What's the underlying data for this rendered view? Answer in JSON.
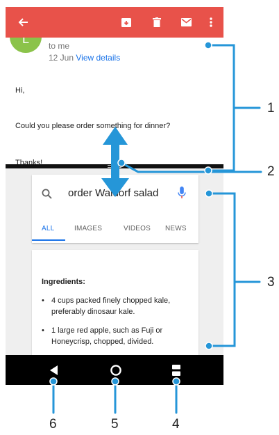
{
  "toolbar": {
    "back_icon": "arrow-left-icon",
    "archive_icon": "archive-icon",
    "delete_icon": "trash-icon",
    "mark_unread_icon": "envelope-icon",
    "more_icon": "more-vertical-icon"
  },
  "email": {
    "avatar_letter": "L",
    "to_line": "to me",
    "date": "12 Jun",
    "details_link": "View details",
    "greeting": "Hi,",
    "body": "Could you please order something for dinner?",
    "signoff": "Thanks!"
  },
  "search": {
    "query": "order Waldorf salad",
    "search_icon": "search-icon",
    "mic_icon": "microphone-icon",
    "tabs": [
      "ALL",
      "IMAGES",
      "VIDEOS",
      "NEWS"
    ],
    "active_tab": "ALL"
  },
  "result": {
    "heading": "Ingredients:",
    "items": [
      "4 cups packed finely chopped kale, preferably dinosaur kale.",
      "1 large red apple, such as Fuji or Honeycrisp, chopped, divided."
    ]
  },
  "navbar": {
    "back_icon": "back-triangle-icon",
    "home_icon": "home-circle-icon",
    "recents_icon": "recents-split-icon"
  },
  "callouts": [
    "1",
    "2",
    "3",
    "4",
    "5",
    "6"
  ],
  "colors": {
    "app_bar": "#e8524a",
    "accent": "#1a73e8",
    "callout": "#2596d8",
    "nav_bar": "#000000",
    "divider": "#111111"
  }
}
